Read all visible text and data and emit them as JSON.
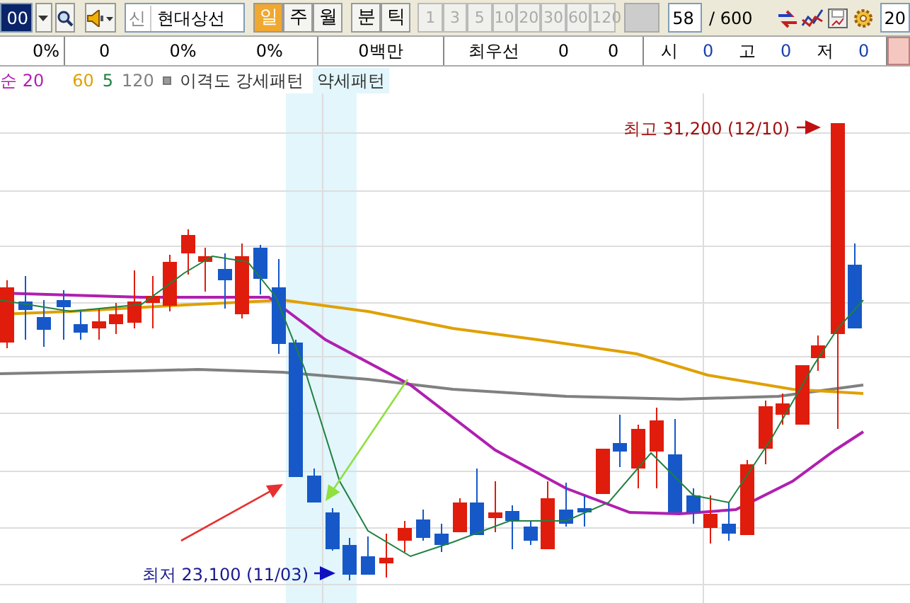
{
  "toolbar": {
    "code_field": {
      "value": "00"
    },
    "stock_prefix": "신",
    "stock_name": "현대상선",
    "period_tabs": [
      {
        "label": "일",
        "selected": true
      },
      {
        "label": "주",
        "selected": false
      },
      {
        "label": "월",
        "selected": false
      }
    ],
    "interval_tabs": [
      {
        "label": "분",
        "selected": false
      },
      {
        "label": "틱",
        "selected": false
      }
    ],
    "interval_numbers": [
      {
        "label": "1",
        "disabled": true
      },
      {
        "label": "3",
        "disabled": true
      },
      {
        "label": "5",
        "disabled": true
      },
      {
        "label": "10",
        "disabled": true
      },
      {
        "label": "20",
        "disabled": true
      },
      {
        "label": "30",
        "disabled": true
      },
      {
        "label": "60",
        "disabled": true
      },
      {
        "label": "120",
        "disabled": true
      }
    ],
    "count_field": {
      "value": "58"
    },
    "count_total": "/ 600",
    "right_field": {
      "value": "20"
    }
  },
  "quote_bar": [
    {
      "items": [
        {
          "text": "0%",
          "kind": "value"
        }
      ]
    },
    {
      "items": [
        {
          "text": "0",
          "kind": "value"
        },
        {
          "text": "0%",
          "kind": "value"
        },
        {
          "text": "0%",
          "kind": "value"
        }
      ]
    },
    {
      "items": [
        {
          "text": "0백만",
          "kind": "value"
        }
      ]
    },
    {
      "items": [
        {
          "text": "최우선",
          "kind": "label"
        },
        {
          "text": "0",
          "kind": "value"
        },
        {
          "text": "0",
          "kind": "value"
        }
      ]
    },
    {
      "items": [
        {
          "text": "시",
          "kind": "label"
        },
        {
          "text": "0",
          "kind": "quote"
        },
        {
          "text": "고",
          "kind": "label"
        },
        {
          "text": "0",
          "kind": "quote"
        },
        {
          "text": "저",
          "kind": "label"
        },
        {
          "text": "0",
          "kind": "quote"
        }
      ]
    }
  ],
  "chart": {
    "legend": [
      {
        "label": "순 20",
        "color": "#b01fb0"
      },
      {
        "label": "60",
        "color": "#e0a000"
      },
      {
        "label": "5",
        "color": "#208040"
      },
      {
        "label": "120",
        "color": "#808080"
      }
    ],
    "pattern_labels": [
      {
        "label": "이격도 강세패턴",
        "highlighted": false
      },
      {
        "label": "약세패턴",
        "highlighted": true
      }
    ],
    "high_label": "최고 31,200 (12/10)",
    "low_label": "최저 23,100 (11/03)"
  }
}
